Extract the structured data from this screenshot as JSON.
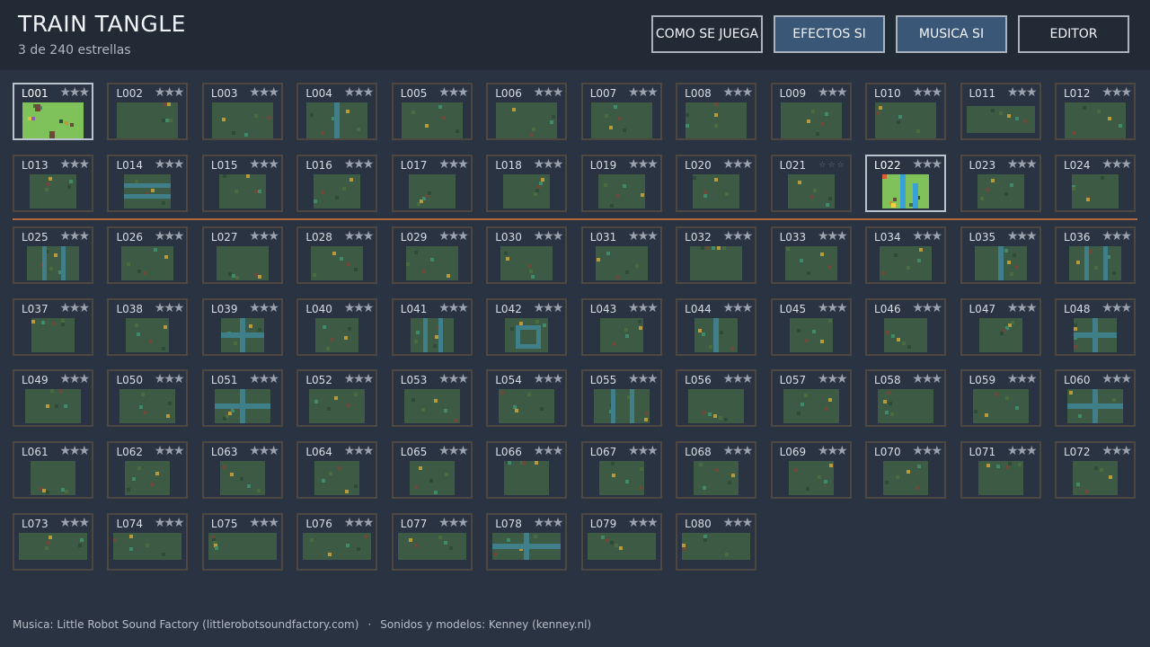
{
  "title": "TRAIN TANGLE",
  "subtitle": "3 de 240 estrellas",
  "buttons": [
    {
      "label": "COMO SE JUEGA",
      "active": false
    },
    {
      "label": "EFECTOS SI",
      "active": true
    },
    {
      "label": "MUSICA SI",
      "active": true
    },
    {
      "label": "EDITOR",
      "active": false
    }
  ],
  "levels": [
    {
      "id": "L001",
      "stars": "★★★",
      "selected": true,
      "bright": true,
      "feature": "blocks"
    },
    {
      "id": "L002",
      "stars": "★★★",
      "feature": "plain"
    },
    {
      "id": "L003",
      "stars": "★★★",
      "feature": "plain"
    },
    {
      "id": "L004",
      "stars": "★★★",
      "feature": "vline"
    },
    {
      "id": "L005",
      "stars": "★★★",
      "feature": "plain"
    },
    {
      "id": "L006",
      "stars": "★★★",
      "feature": "plain"
    },
    {
      "id": "L007",
      "stars": "★★★",
      "feature": "plain"
    },
    {
      "id": "L008",
      "stars": "★★★",
      "feature": "plain"
    },
    {
      "id": "L009",
      "stars": "★★★",
      "feature": "plain"
    },
    {
      "id": "L010",
      "stars": "★★★",
      "feature": "plain"
    },
    {
      "id": "L011",
      "stars": "★★★",
      "feature": "wide"
    },
    {
      "id": "L012",
      "stars": "★★★",
      "feature": "plain"
    },
    {
      "id": "L013",
      "stars": "★★★",
      "feature": "plain"
    },
    {
      "id": "L014",
      "stars": "★★★",
      "feature": "hlines"
    },
    {
      "id": "L015",
      "stars": "★★★",
      "feature": "plain"
    },
    {
      "id": "L016",
      "stars": "★★★",
      "feature": "plain"
    },
    {
      "id": "L017",
      "stars": "★★★",
      "feature": "plain"
    },
    {
      "id": "L018",
      "stars": "★★★",
      "feature": "plain"
    },
    {
      "id": "L019",
      "stars": "★★★",
      "feature": "plain"
    },
    {
      "id": "L020",
      "stars": "★★★",
      "feature": "plain"
    },
    {
      "id": "L021",
      "stars": "☆☆☆",
      "empty": true,
      "feature": "plain"
    },
    {
      "id": "L022",
      "stars": "★★★",
      "selected": true,
      "bright": true,
      "feature": "river"
    },
    {
      "id": "L023",
      "stars": "★★★",
      "feature": "plain"
    },
    {
      "id": "L024",
      "stars": "★★★",
      "feature": "plain"
    },
    {
      "id": "L025",
      "stars": "★★★",
      "feature": "vline2"
    },
    {
      "id": "L026",
      "stars": "★★★",
      "feature": "plain"
    },
    {
      "id": "L027",
      "stars": "★★★",
      "feature": "plain"
    },
    {
      "id": "L028",
      "stars": "★★★",
      "feature": "plain"
    },
    {
      "id": "L029",
      "stars": "★★★",
      "feature": "plain"
    },
    {
      "id": "L030",
      "stars": "★★★",
      "feature": "plain"
    },
    {
      "id": "L031",
      "stars": "★★★",
      "feature": "plain"
    },
    {
      "id": "L032",
      "stars": "★★★",
      "feature": "plain"
    },
    {
      "id": "L033",
      "stars": "★★★",
      "feature": "plain"
    },
    {
      "id": "L034",
      "stars": "★★★",
      "feature": "plain"
    },
    {
      "id": "L035",
      "stars": "★★★",
      "feature": "vline"
    },
    {
      "id": "L036",
      "stars": "★★★",
      "feature": "vline2"
    },
    {
      "id": "L037",
      "stars": "★★★",
      "feature": "plain"
    },
    {
      "id": "L038",
      "stars": "★★★",
      "feature": "plain"
    },
    {
      "id": "L039",
      "stars": "★★★",
      "feature": "cross"
    },
    {
      "id": "L040",
      "stars": "★★★",
      "feature": "plain"
    },
    {
      "id": "L041",
      "stars": "★★★",
      "feature": "vline2"
    },
    {
      "id": "L042",
      "stars": "★★★",
      "feature": "ring"
    },
    {
      "id": "L043",
      "stars": "★★★",
      "feature": "plain"
    },
    {
      "id": "L044",
      "stars": "★★★",
      "feature": "vline"
    },
    {
      "id": "L045",
      "stars": "★★★",
      "feature": "plain"
    },
    {
      "id": "L046",
      "stars": "★★★",
      "feature": "plain"
    },
    {
      "id": "L047",
      "stars": "★★★",
      "feature": "plain"
    },
    {
      "id": "L048",
      "stars": "★★★",
      "feature": "cross"
    },
    {
      "id": "L049",
      "stars": "★★★",
      "feature": "plain"
    },
    {
      "id": "L050",
      "stars": "★★★",
      "feature": "plain"
    },
    {
      "id": "L051",
      "stars": "★★★",
      "feature": "cross"
    },
    {
      "id": "L052",
      "stars": "★★★",
      "feature": "plain"
    },
    {
      "id": "L053",
      "stars": "★★★",
      "feature": "plain"
    },
    {
      "id": "L054",
      "stars": "★★★",
      "feature": "plain"
    },
    {
      "id": "L055",
      "stars": "★★★",
      "feature": "vline2"
    },
    {
      "id": "L056",
      "stars": "★★★",
      "feature": "plain"
    },
    {
      "id": "L057",
      "stars": "★★★",
      "feature": "plain"
    },
    {
      "id": "L058",
      "stars": "★★★",
      "feature": "plain"
    },
    {
      "id": "L059",
      "stars": "★★★",
      "feature": "plain"
    },
    {
      "id": "L060",
      "stars": "★★★",
      "feature": "cross"
    },
    {
      "id": "L061",
      "stars": "★★★",
      "feature": "plain"
    },
    {
      "id": "L062",
      "stars": "★★★",
      "feature": "plain"
    },
    {
      "id": "L063",
      "stars": "★★★",
      "feature": "plain"
    },
    {
      "id": "L064",
      "stars": "★★★",
      "feature": "plain"
    },
    {
      "id": "L065",
      "stars": "★★★",
      "feature": "plain"
    },
    {
      "id": "L066",
      "stars": "★★★",
      "feature": "plain"
    },
    {
      "id": "L067",
      "stars": "★★★",
      "feature": "plain"
    },
    {
      "id": "L068",
      "stars": "★★★",
      "feature": "plain"
    },
    {
      "id": "L069",
      "stars": "★★★",
      "feature": "plain"
    },
    {
      "id": "L070",
      "stars": "★★★",
      "feature": "plain"
    },
    {
      "id": "L071",
      "stars": "★★★",
      "feature": "plain"
    },
    {
      "id": "L072",
      "stars": "★★★",
      "feature": "plain"
    },
    {
      "id": "L073",
      "stars": "★★★",
      "feature": "plain"
    },
    {
      "id": "L074",
      "stars": "★★★",
      "feature": "plain"
    },
    {
      "id": "L075",
      "stars": "★★★",
      "feature": "plain"
    },
    {
      "id": "L076",
      "stars": "★★★",
      "feature": "plain"
    },
    {
      "id": "L077",
      "stars": "★★★",
      "feature": "plain"
    },
    {
      "id": "L078",
      "stars": "★★★",
      "feature": "cross"
    },
    {
      "id": "L079",
      "stars": "★★★",
      "feature": "plain"
    },
    {
      "id": "L080",
      "stars": "★★★",
      "feature": "plain"
    }
  ],
  "footer": {
    "music": "Musica: Little Robot Sound Factory (littlerobotsoundfactory.com)",
    "separator": "·",
    "sounds": "Sonidos y modelos: Kenney (kenney.nl)"
  },
  "colors": {
    "background": "#2a3342",
    "header": "#222a36",
    "button_active": "#3a5777",
    "card_border": "#4d4740",
    "card_selected_border": "#b9c3cc",
    "divider": "#b06a3c",
    "thumb_dark": "#3c5a44",
    "thumb_bright": "#7fc25a",
    "track": "#3f7f8a"
  }
}
